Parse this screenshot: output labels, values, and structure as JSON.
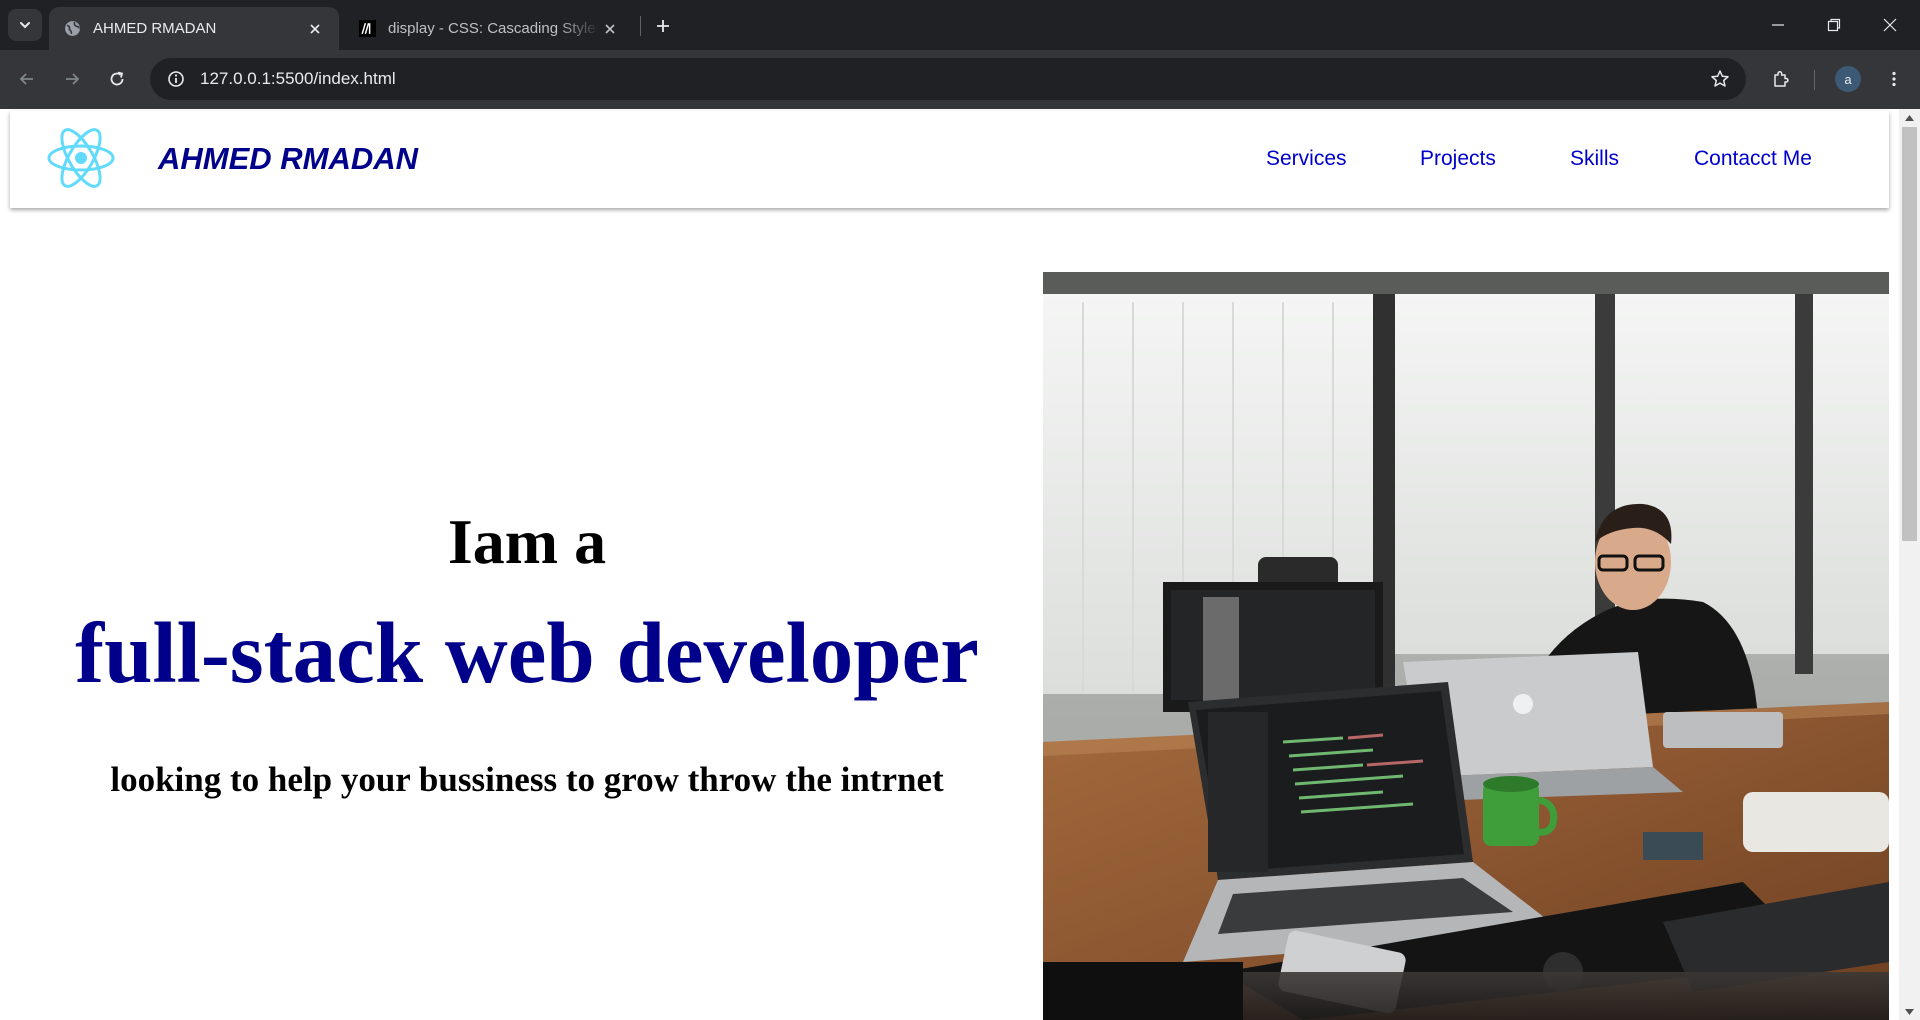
{
  "browser": {
    "tabs": [
      {
        "title": "AHMED RMADAN",
        "active": true,
        "favicon": "globe-icon"
      },
      {
        "title": "display - CSS: Cascading Style Sheets | MDN",
        "active": false,
        "favicon": "mdn-icon"
      }
    ],
    "url": "127.0.0.1:5500/index.html",
    "profile_initial": "a"
  },
  "site": {
    "brand": "AHMED RMADAN",
    "logo": "react-atom-icon",
    "nav": [
      "Services",
      "Projects",
      "Skills",
      "Contacct Me"
    ]
  },
  "hero": {
    "line1": "Iam a",
    "line2": "full-stack web developer",
    "line3": "looking to help your bussiness to grow throw the intrnet",
    "image": "office-developer-photo"
  },
  "colors": {
    "brand": "#00008b",
    "nav_link": "#0000cd",
    "logo": "#61dafb",
    "chrome_bg": "#202124",
    "chrome_toolbar": "#35363a"
  }
}
